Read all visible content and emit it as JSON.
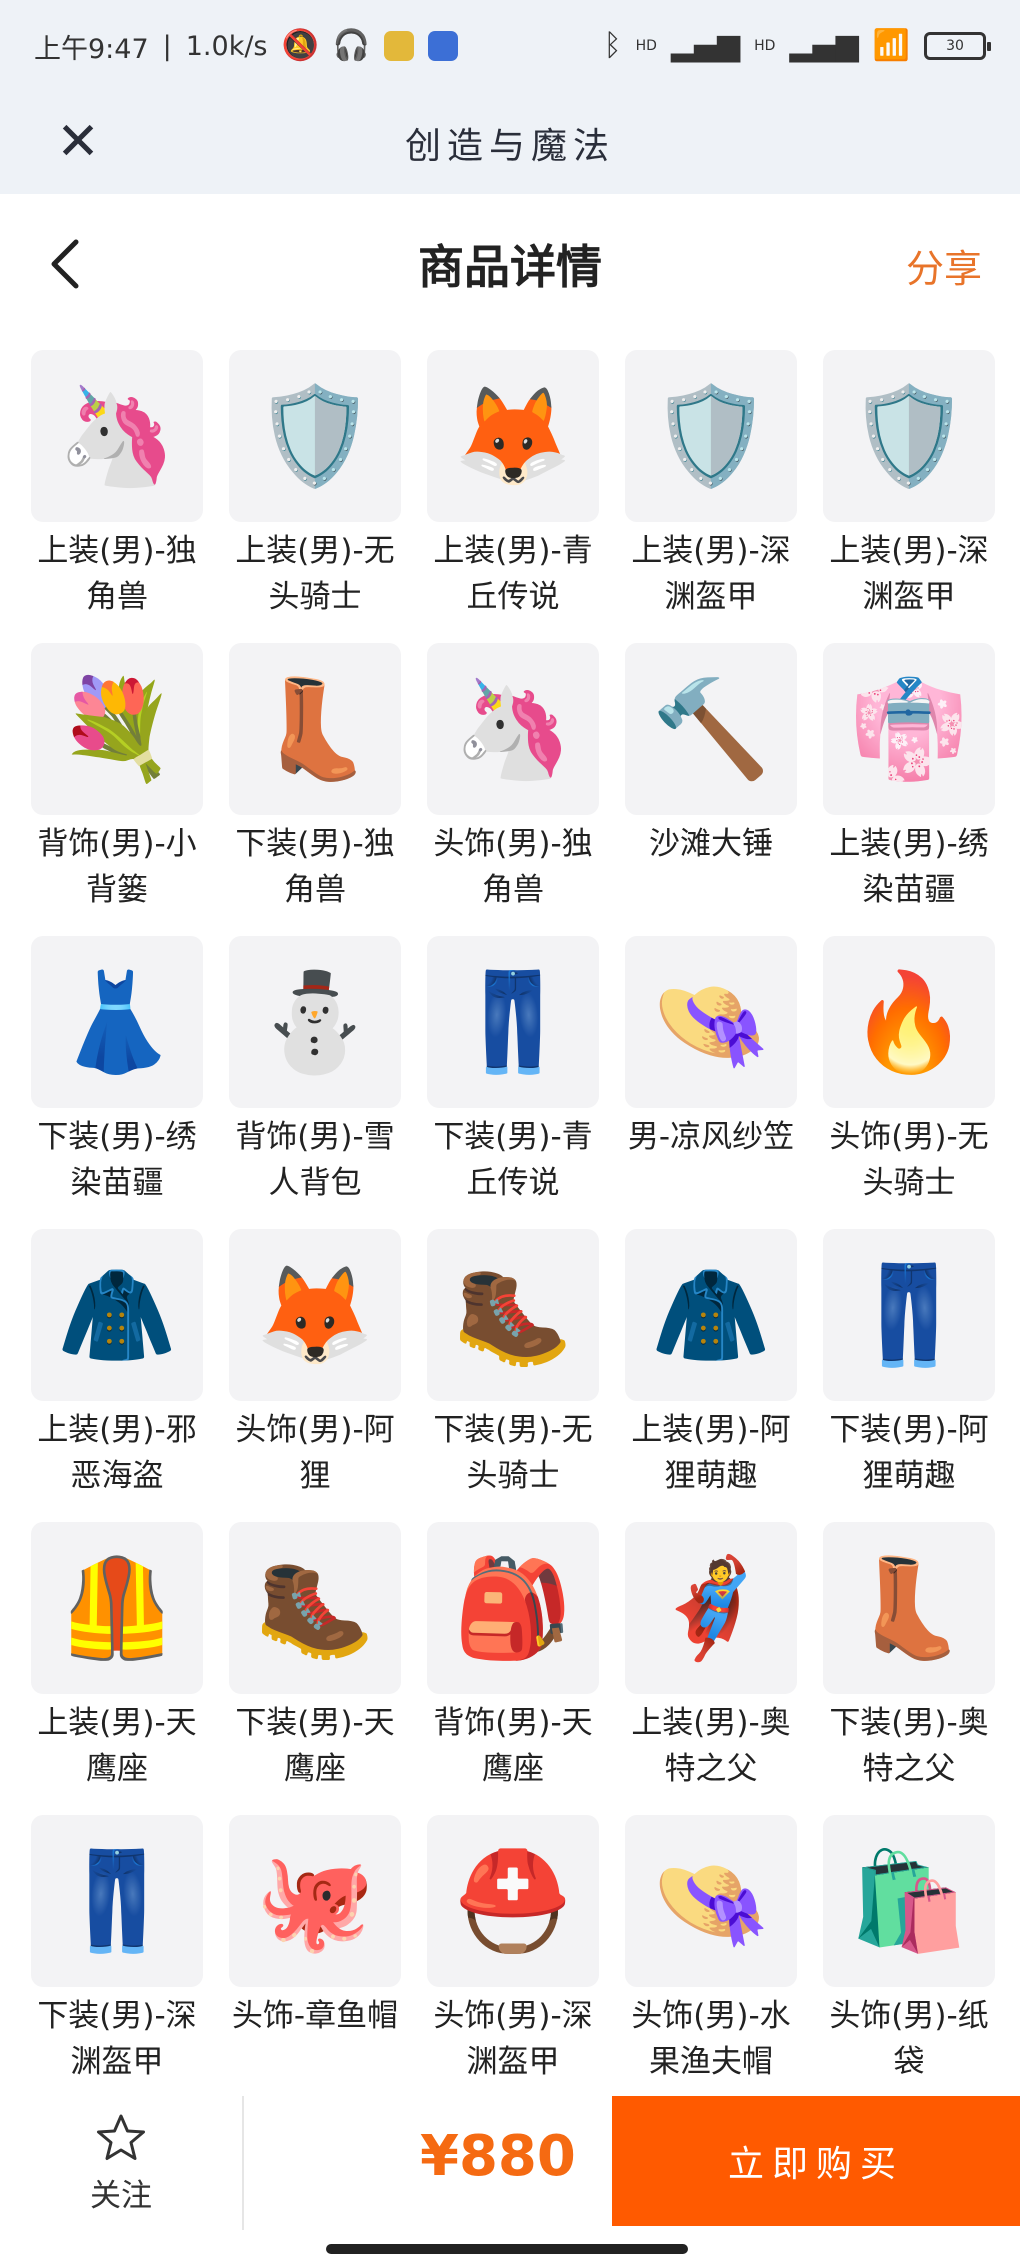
{
  "status_bar": {
    "time": "上午9:47",
    "speed": "1.0k/s",
    "battery": "30",
    "hd1": "HD",
    "hd2": "HD"
  },
  "title_bar": {
    "title": "创造与魔法"
  },
  "header": {
    "title": "商品详情",
    "share": "分享"
  },
  "items": [
    {
      "name": "上装(男)-独角兽",
      "icon": "🦄"
    },
    {
      "name": "上装(男)-无头骑士",
      "icon": "🛡️"
    },
    {
      "name": "上装(男)-青丘传说",
      "icon": "🦊"
    },
    {
      "name": "上装(男)-深渊盔甲",
      "icon": "🛡️"
    },
    {
      "name": "上装(男)-深渊盔甲",
      "icon": "🛡️"
    },
    {
      "name": "背饰(男)-小背篓",
      "icon": "💐"
    },
    {
      "name": "下装(男)-独角兽",
      "icon": "👢"
    },
    {
      "name": "头饰(男)-独角兽",
      "icon": "🦄"
    },
    {
      "name": "沙滩大锤",
      "icon": "🔨"
    },
    {
      "name": "上装(男)-绣染苗疆",
      "icon": "👘"
    },
    {
      "name": "下装(男)-绣染苗疆",
      "icon": "👗"
    },
    {
      "name": "背饰(男)-雪人背包",
      "icon": "⛄"
    },
    {
      "name": "下装(男)-青丘传说",
      "icon": "👖"
    },
    {
      "name": "男-凉风纱笠",
      "icon": "👒"
    },
    {
      "name": "头饰(男)-无头骑士",
      "icon": "🔥"
    },
    {
      "name": "上装(男)-邪恶海盗",
      "icon": "🧥"
    },
    {
      "name": "头饰(男)-阿狸",
      "icon": "🦊"
    },
    {
      "name": "下装(男)-无头骑士",
      "icon": "🥾"
    },
    {
      "name": "上装(男)-阿狸萌趣",
      "icon": "🧥"
    },
    {
      "name": "下装(男)-阿狸萌趣",
      "icon": "👖"
    },
    {
      "name": "上装(男)-天鹰座",
      "icon": "🦺"
    },
    {
      "name": "下装(男)-天鹰座",
      "icon": "🥾"
    },
    {
      "name": "背饰(男)-天鹰座",
      "icon": "🎒"
    },
    {
      "name": "上装(男)-奥特之父",
      "icon": "🦸"
    },
    {
      "name": "下装(男)-奥特之父",
      "icon": "👢"
    },
    {
      "name": "下装(男)-深渊盔甲",
      "icon": "👖"
    },
    {
      "name": "头饰-章鱼帽",
      "icon": "🐙"
    },
    {
      "name": "头饰(男)-深渊盔甲",
      "icon": "⛑️"
    },
    {
      "name": "头饰(男)-水果渔夫帽",
      "icon": "👒"
    },
    {
      "name": "头饰(男)-纸袋",
      "icon": "🛍️"
    }
  ],
  "bottom_bar": {
    "follow_label": "关注",
    "price": "¥880",
    "buy_label": "立即购买"
  },
  "colors": {
    "accent": "#ff5a00",
    "price": "#f56a12",
    "share": "#e8742a"
  }
}
